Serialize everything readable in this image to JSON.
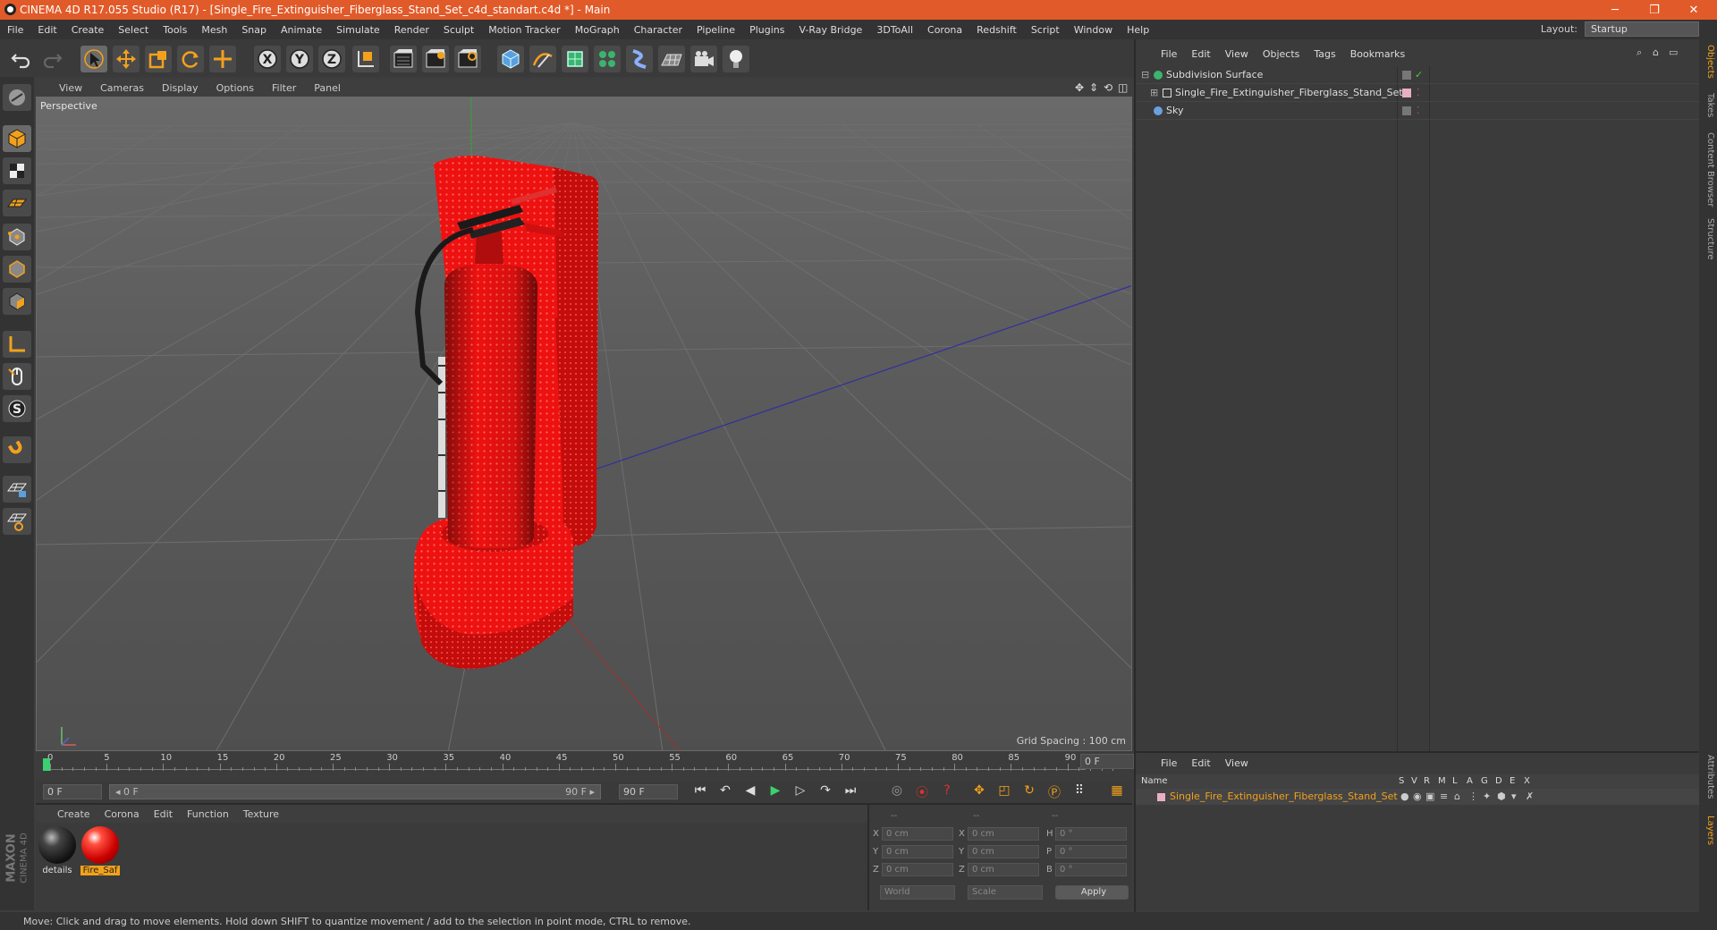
{
  "window": {
    "title": "CINEMA 4D R17.055 Studio (R17) - [Single_Fire_Extinguisher_Fiberglass_Stand_Set_c4d_standart.c4d *] - Main",
    "controls": {
      "minimize": "─",
      "restore": "❐",
      "close": "✕"
    }
  },
  "menubar": {
    "items": [
      "File",
      "Edit",
      "Create",
      "Select",
      "Tools",
      "Mesh",
      "Snap",
      "Animate",
      "Simulate",
      "Render",
      "Sculpt",
      "Motion Tracker",
      "MoGraph",
      "Character",
      "Pipeline",
      "Plugins",
      "V-Ray Bridge",
      "3DToAll",
      "Corona",
      "Redshift",
      "Script",
      "Window",
      "Help"
    ],
    "layout_label": "Layout:",
    "layout_value": "Startup"
  },
  "toolbar": {
    "icons": [
      "undo-icon",
      "redo-icon",
      "select-pointer-icon",
      "move-icon",
      "scale-icon",
      "rotate-icon",
      "move-plus-icon",
      "x-axis-lock-icon",
      "y-axis-lock-icon",
      "z-axis-lock-icon",
      "world-coordinate-icon",
      "render-view-icon",
      "render-picture-viewer-icon",
      "edit-render-settings-icon",
      "cube-primitive-icon",
      "pen-spline-icon",
      "subdivision-icon",
      "mograph-cloner-icon",
      "deformer-icon",
      "floor-scene-icon",
      "camera-icon",
      "light-icon"
    ],
    "axis_labels": [
      "X",
      "Y",
      "Z"
    ]
  },
  "left_tools": {
    "icons": [
      "make-editable-icon",
      "model-mode-icon",
      "texture-mode-icon",
      "workplane-icon",
      "points-mode-icon",
      "edges-mode-icon",
      "polygons-mode-icon",
      "axis-mode-icon",
      "tweak-mode-icon",
      "snapping-icon",
      "magnet-icon",
      "grid-lock-icon",
      "planar-grid-icon"
    ]
  },
  "viewport": {
    "menu": [
      "View",
      "Cameras",
      "Display",
      "Options",
      "Filter",
      "Panel"
    ],
    "label": "Perspective",
    "grid_spacing": "Grid Spacing : 100 cm",
    "nav_icons": [
      "pan-icon",
      "zoom-icon",
      "orbit-icon",
      "maximize-view-icon"
    ]
  },
  "timeline": {
    "ticks": [
      "0",
      "5",
      "10",
      "15",
      "20",
      "25",
      "30",
      "35",
      "40",
      "45",
      "50",
      "55",
      "60",
      "65",
      "70",
      "75",
      "80",
      "85",
      "90"
    ],
    "current_frame": "0 F",
    "start_field": "0 F",
    "range_start": "◂ 0 F",
    "range_end": "90 F ▸",
    "end_field": "90 F",
    "transport_icons": [
      "go-to-start-icon",
      "previous-key-icon",
      "play-reverse-icon",
      "play-icon",
      "next-frame-icon",
      "next-key-icon",
      "go-to-end-icon"
    ],
    "key_icons": [
      "keyframe-record-icon",
      "autokey-icon",
      "key-help-icon",
      "move-key-icon",
      "scale-key-icon",
      "rotate-key-icon",
      "param-key-icon",
      "point-level-icon",
      "timeline-window-icon"
    ]
  },
  "materials": {
    "menu": [
      "Create",
      "Corona",
      "Edit",
      "Function",
      "Texture"
    ],
    "items": [
      {
        "name": "details"
      },
      {
        "name": "Fire_Saf"
      }
    ]
  },
  "coordinates": {
    "header": [
      "--",
      "--",
      "--"
    ],
    "rows": [
      {
        "l1": "X",
        "v1": "0 cm",
        "l2": "X",
        "v2": "0 cm",
        "l3": "H",
        "v3": "0 °"
      },
      {
        "l1": "Y",
        "v1": "0 cm",
        "l2": "Y",
        "v2": "0 cm",
        "l3": "P",
        "v3": "0 °"
      },
      {
        "l1": "Z",
        "v1": "0 cm",
        "l2": "Z",
        "v2": "0 cm",
        "l3": "B",
        "v3": "0 °"
      }
    ],
    "mode": "World",
    "size_mode": "Scale",
    "apply": "Apply"
  },
  "objects": {
    "menu": [
      "File",
      "Edit",
      "View",
      "Objects",
      "Tags",
      "Bookmarks"
    ],
    "items": [
      {
        "name": "Subdivision Surface",
        "icon": "subdivision-surface-icon"
      },
      {
        "name": "Single_Fire_Extinguisher_Fiberglass_Stand_Set",
        "icon": "null-object-icon"
      },
      {
        "name": "Sky",
        "icon": "sky-icon"
      }
    ]
  },
  "right_tabs": [
    "Objects",
    "Takes",
    "Content Browser",
    "Structure",
    "Attributes",
    "Layers"
  ],
  "layers": {
    "menu": [
      "File",
      "Edit",
      "View"
    ],
    "columns": [
      "Name",
      "S",
      "V",
      "R",
      "M",
      "L",
      "A",
      "G",
      "D",
      "E",
      "X"
    ],
    "row_name": "Single_Fire_Extinguisher_Fiberglass_Stand_Set"
  },
  "status": "Move: Click and drag to move elements. Hold down SHIFT to quantize movement / add to the selection in point mode, CTRL to remove.",
  "brand": {
    "line1": "MAXON",
    "line2": "CINEMA 4D"
  },
  "colors": {
    "title_bar": "#e15a29",
    "accent_orange": "#f2a11c",
    "model_red": "#f01010",
    "layer_name": "#f2a11c"
  }
}
